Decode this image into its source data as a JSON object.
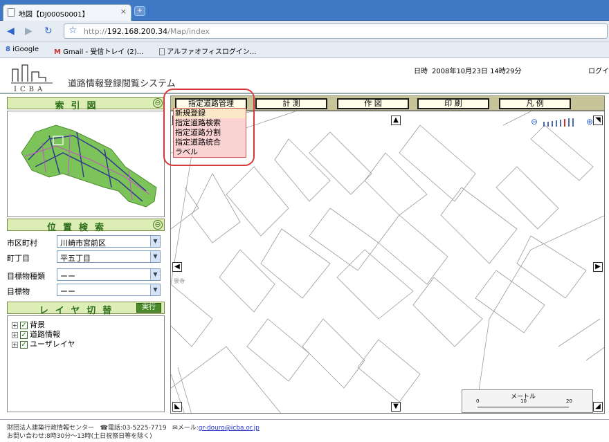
{
  "browser": {
    "tab_title": "地図【DJ000S0001】",
    "tab_close": "×",
    "new_tab": "+",
    "url_prefix": "http://",
    "url_host": "192.168.200.34",
    "url_path": "/Map/index",
    "bookmarks": [
      {
        "label": "iGoogle",
        "icon": "google-icon"
      },
      {
        "label": "Gmail - 受信トレイ (2)...",
        "icon": "gmail-icon"
      },
      {
        "label": "アルファオフィスログイン...",
        "icon": "page-icon"
      }
    ]
  },
  "header": {
    "logo_text": "ICBA",
    "system_name": "道路情報登録閲覧システム",
    "datetime_label": "日時",
    "datetime_value": "2008年10月23日 14時29分",
    "login_label": "ログイ"
  },
  "index_panel": {
    "title": "索引図",
    "collapse": "⊖"
  },
  "position_panel": {
    "title": "位置検索",
    "collapse": "⊖",
    "fields": [
      {
        "label": "市区町村",
        "value": "川崎市宮前区"
      },
      {
        "label": "町丁目",
        "value": "平五丁目"
      },
      {
        "label": "目標物種類",
        "value": "ーー"
      },
      {
        "label": "目標物",
        "value": "ーー"
      }
    ]
  },
  "layer_panel": {
    "title": "レイヤ切替",
    "exec_label": "実行",
    "layers": [
      {
        "label": "背景",
        "checked": true
      },
      {
        "label": "道路情報",
        "checked": true
      },
      {
        "label": "ユーザレイヤ",
        "checked": true
      }
    ]
  },
  "menu": {
    "items": [
      "指定道路管理",
      "計 測",
      "作 図",
      "印 刷",
      "凡 例"
    ],
    "dropdown": [
      "新規登録",
      "指定道路検索",
      "指定道路分割",
      "指定道路統合",
      "ラベル"
    ]
  },
  "map": {
    "scale_label": "メートル",
    "scale_ticks": [
      "0",
      "10",
      "20"
    ],
    "place_label": "景寺"
  },
  "footer": {
    "line1_org": "財団法人建築行政情報センター",
    "line1_tel": "☎電話:03-5225-7719",
    "line1_mail_label": "✉メール:",
    "line1_mail": "gr-douro@icba.or.jp",
    "line2": "お問い合わせ:8時30分～13時(土日祝祭日等を除く)"
  },
  "colors": {
    "accent_green": "#4a8a2a",
    "panel_header": "#dcedb5",
    "menu_bar": "#c8c49a",
    "highlight_red": "#d63a3a"
  }
}
